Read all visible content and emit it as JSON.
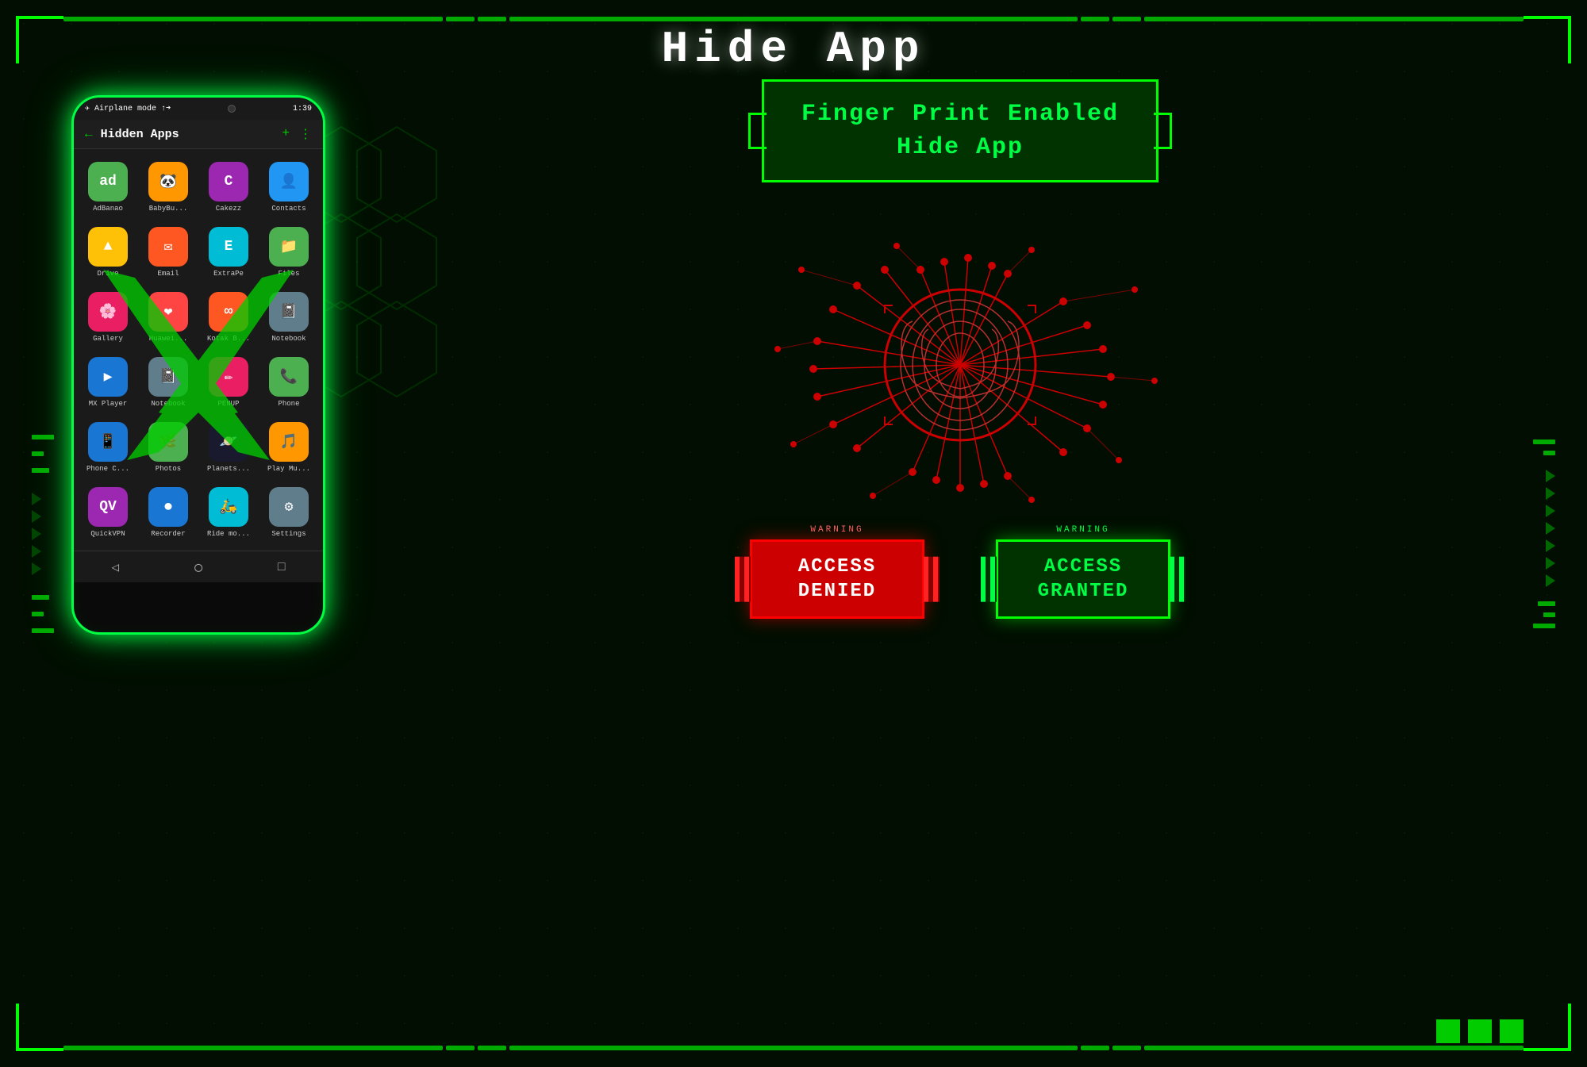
{
  "title": "Hide App",
  "fingerprint_title_line1": "Finger Print Enabled",
  "fingerprint_title_line2": "Hide App",
  "phone": {
    "status_bar": {
      "left": "Airplane mode",
      "right": "1:39"
    },
    "header": {
      "title": "Hidden Apps"
    },
    "apps": [
      {
        "name": "AdBanao",
        "color": "#4CAF50",
        "label": "ad"
      },
      {
        "name": "BabyBu...",
        "color": "#FF9800",
        "label": "🐼"
      },
      {
        "name": "Cakezz",
        "color": "#9C27B0",
        "label": "C"
      },
      {
        "name": "Contacts",
        "color": "#2196F3",
        "label": "👤"
      },
      {
        "name": "Drive",
        "color": "#FFC107",
        "label": "▲"
      },
      {
        "name": "Email",
        "color": "#FF5722",
        "label": "✉"
      },
      {
        "name": "ExtraPe",
        "color": "#00BCD4",
        "label": "E"
      },
      {
        "name": "Files",
        "color": "#4CAF50",
        "label": "📁"
      },
      {
        "name": "Gallery",
        "color": "#E91E63",
        "label": "🌸"
      },
      {
        "name": "Huawei...",
        "color": "#FF4444",
        "label": "❤"
      },
      {
        "name": "Kotak B...",
        "color": "#FF5722",
        "label": "∞"
      },
      {
        "name": "Notebook",
        "color": "#607D8B",
        "label": "📓"
      },
      {
        "name": "MX Player",
        "color": "#1976D2",
        "label": "▶"
      },
      {
        "name": "Notebook",
        "color": "#607D8B",
        "label": "📓"
      },
      {
        "name": "PENUP",
        "color": "#E91E63",
        "label": "✏"
      },
      {
        "name": "Phone",
        "color": "#4CAF50",
        "label": "📞"
      },
      {
        "name": "Phone C...",
        "color": "#1976D2",
        "label": "📱"
      },
      {
        "name": "Photos",
        "color": "#4CAF50",
        "label": "🌿"
      },
      {
        "name": "Planets...",
        "color": "#1a1a2e",
        "label": "🪐"
      },
      {
        "name": "Play Mu...",
        "color": "#FF9800",
        "label": "🎵"
      },
      {
        "name": "QuickVPN",
        "color": "#9C27B0",
        "label": "QV"
      },
      {
        "name": "Recorder",
        "color": "#1976D2",
        "label": "⏺"
      },
      {
        "name": "Ride mo...",
        "color": "#00BCD4",
        "label": "🛵"
      },
      {
        "name": "Settings",
        "color": "#607D8B",
        "label": "⚙"
      }
    ]
  },
  "access_denied": {
    "warning": "WARNING",
    "label": "ACCESS\nDENIED"
  },
  "access_granted": {
    "warning": "WARNING",
    "label": "ACCESS\nGRANTED"
  },
  "bottom_squares_count": 3
}
